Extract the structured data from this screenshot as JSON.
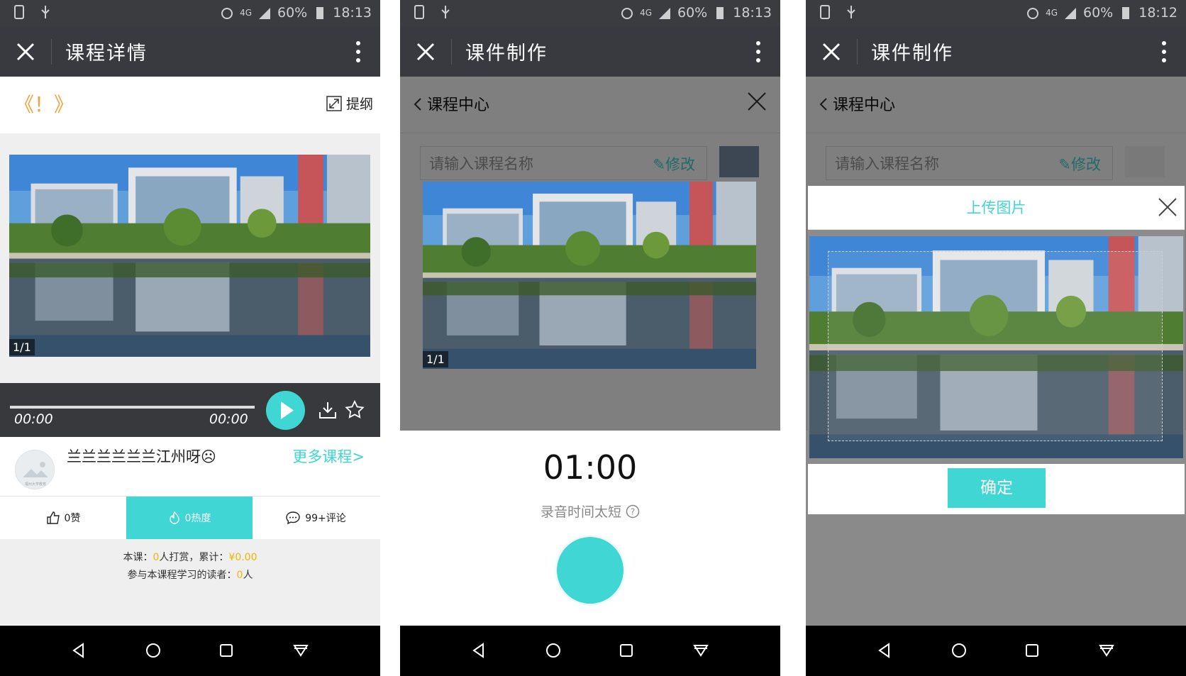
{
  "status": [
    {
      "signal": "4G",
      "battery": "60%",
      "time": "18:13"
    },
    {
      "signal": "4G",
      "battery": "60%",
      "time": "18:13"
    },
    {
      "signal": "4G",
      "battery": "60%",
      "time": "18:12"
    }
  ],
  "screen1": {
    "title": "课程详情",
    "brackets": "《！》",
    "outline_label": "提纲",
    "pager": "1/1",
    "time_current": "00:00",
    "time_total": "00:00",
    "author_name": "兰兰兰兰兰兰江州呀☹",
    "more_courses": "更多课程>",
    "avatar_caption": "福州大学教育",
    "stats": [
      {
        "label": "0赞"
      },
      {
        "label": "0热度",
        "active": true
      },
      {
        "label": "99+评论"
      }
    ],
    "reward_line1_pre": "本课：",
    "reward_line1_count": "0",
    "reward_line1_mid": "人打赏，累计：",
    "reward_line1_amount": "¥0.00",
    "reward_line2_pre": "参与本课程学习的读者：",
    "reward_line2_count": "0",
    "reward_line2_post": "人"
  },
  "screen2": {
    "title": "课件制作",
    "subnav_label": "课程中心",
    "input_placeholder": "请输入课程名称",
    "edit_label": "修改",
    "pager": "1/1",
    "timer": "01:00",
    "hint": "录音时间太短"
  },
  "screen3": {
    "title": "课件制作",
    "subnav_label": "课程中心",
    "input_placeholder": "请输入课程名称",
    "edit_label": "修改",
    "dialog_title": "上传图片",
    "confirm_label": "确定"
  },
  "colors": {
    "accent": "#3fd6d3",
    "bar": "#393a3f",
    "orange": "#f0a23c",
    "gold": "#f0b400"
  }
}
